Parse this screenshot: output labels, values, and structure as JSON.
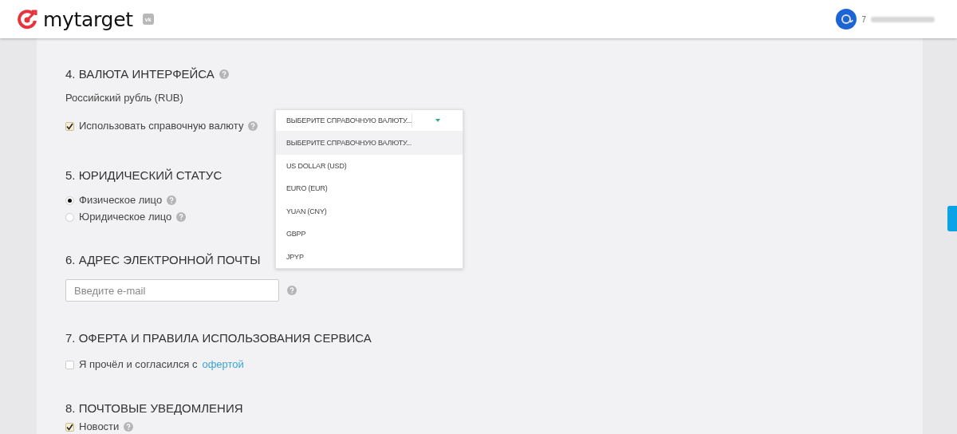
{
  "header": {
    "logo_text": "mytarget",
    "badge": "vk",
    "user": {
      "name": "7"
    }
  },
  "sections": [
    {
      "title": "4. ВАЛЮТА ИНТЕРФЕЙСА",
      "help": true,
      "items": [
        {
          "kind": "text",
          "label": "Российский рубль (RUB)"
        },
        {
          "kind": "checkbox",
          "label": "Использовать справочную валюту",
          "checked": true,
          "help": true,
          "dropdown": {
            "value": "ВЫБЕРИТЕ СПРАВОЧНУЮ ВАЛЮТУ...",
            "expanded": true,
            "options": [
              {
                "label": "ВЫБЕРИТЕ СПРАВОЧНУЮ ВАЛЮТУ...",
                "selected": true
              },
              {
                "label": "US DOLLAR (USD)",
                "selected": false
              },
              {
                "label": "EURO (EUR)",
                "selected": false
              },
              {
                "label": "YUAN (CNY)",
                "selected": false
              },
              {
                "label": "GBPP",
                "selected": false
              },
              {
                "label": "JPYP",
                "selected": false
              }
            ]
          }
        }
      ]
    },
    {
      "title": "5. ЮРИДИЧЕСКИЙ СТАТУС",
      "items": [
        {
          "kind": "radio",
          "label": "Физическое лицо",
          "selected": true,
          "help": true
        },
        {
          "kind": "radio",
          "label": "Юридическое лицо",
          "selected": false,
          "help": true
        }
      ]
    },
    {
      "title": "6. АДРЕС ЭЛЕКТРОННОЙ ПОЧТЫ",
      "items": [
        {
          "kind": "input",
          "placeholder": "Введите e-mail",
          "help": true
        }
      ]
    },
    {
      "title": "7. ОФЕРТА И ПРАВИЛА ИСПОЛЬЗОВАНИЯ СЕРВИСА",
      "items": [
        {
          "kind": "checkbox",
          "label": "Я прочёл и согласился с",
          "link": "офертой",
          "checked": false
        }
      ]
    },
    {
      "title": "8. ПОЧТОВЫЕ УВЕДОМЛЕНИЯ",
      "items": [
        {
          "kind": "checkbox",
          "label": "Новости",
          "checked": true,
          "help": true
        }
      ]
    }
  ]
}
